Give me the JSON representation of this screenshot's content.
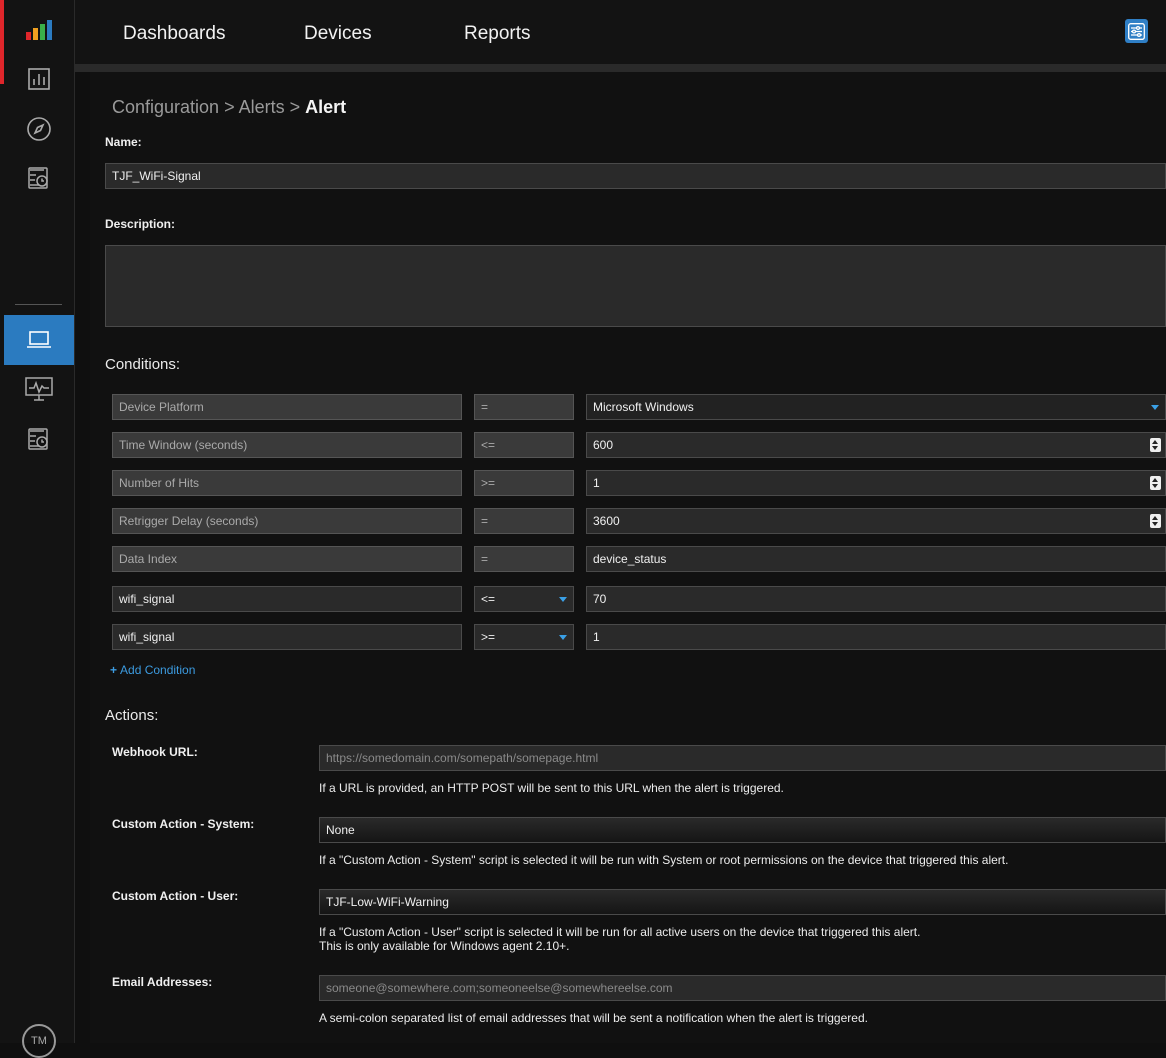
{
  "nav": {
    "dashboards": "Dashboards",
    "devices": "Devices",
    "reports": "Reports"
  },
  "breadcrumb": {
    "part1": "Configuration",
    "sep1": " > ",
    "part2": "Alerts",
    "sep2": " > ",
    "current": "Alert"
  },
  "form": {
    "name_label": "Name:",
    "name_value": "TJF_WiFi-Signal",
    "description_label": "Description:",
    "description_value": "",
    "conditions_heading": "Conditions:",
    "conditions": [
      {
        "field": "Device Platform",
        "op": "=",
        "value": "Microsoft Windows"
      },
      {
        "field": "Time Window (seconds)",
        "op": "<=",
        "value": "600"
      },
      {
        "field": "Number of Hits",
        "op": ">=",
        "value": "1"
      },
      {
        "field": "Retrigger Delay (seconds)",
        "op": "=",
        "value": "3600"
      },
      {
        "field": "Data Index",
        "op": "=",
        "value": "device_status"
      },
      {
        "field": "wifi_signal",
        "op": "<=",
        "value": "70"
      },
      {
        "field": "wifi_signal",
        "op": ">=",
        "value": "1"
      }
    ],
    "add_condition": "Add Condition",
    "actions_heading": "Actions:",
    "webhook_label": "Webhook URL:",
    "webhook_placeholder": "https://somedomain.com/somepath/somepage.html",
    "webhook_help": "If a URL is provided, an HTTP POST will be sent to this URL when the alert is triggered.",
    "system_label": "Custom Action - System:",
    "system_value": "None",
    "system_help": "If a \"Custom Action - System\" script is selected it will be run with System or root permissions on the device that triggered this alert.",
    "user_label": "Custom Action - User:",
    "user_value": "TJF-Low-WiFi-Warning",
    "user_help_1": "If a \"Custom Action - User\" script is selected it will be run for all active users on the device that triggered this alert.",
    "user_help_2": "This is only available for Windows agent 2.10+.",
    "email_label": "Email Addresses:",
    "email_placeholder": "someone@somewhere.com;someoneelse@somewhereelse.com",
    "email_help": "A semi-colon separated list of email addresses that will be sent a notification when the alert is triggered."
  },
  "footer": {
    "tm": "TM"
  },
  "colors": {
    "accent": "#2b7bc0",
    "brand_red": "#e0262b",
    "link": "#3c9be0"
  }
}
